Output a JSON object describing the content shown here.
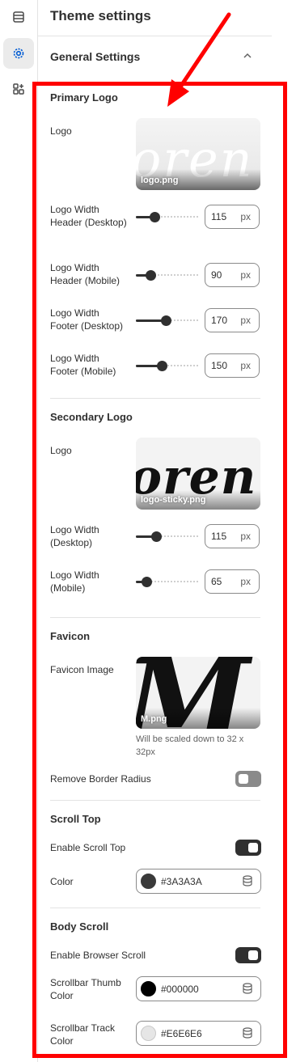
{
  "header": {
    "title": "Theme settings"
  },
  "rail": {
    "icons": [
      "sections-icon",
      "gear-icon",
      "apps-add-icon"
    ]
  },
  "general": {
    "label": "General Settings"
  },
  "primary_logo": {
    "title": "Primary Logo",
    "logo_label": "Logo",
    "logo_file": "logo.png",
    "logo_text": "oren",
    "width_header_desktop": {
      "label": "Logo Width Header (Desktop)",
      "value": "115",
      "unit": "px",
      "min": 0,
      "max": 500
    },
    "width_header_mobile": {
      "label": "Logo Width Header (Mobile)",
      "value": "90",
      "unit": "px",
      "min": 0,
      "max": 500
    },
    "width_footer_desktop": {
      "label": "Logo Width Footer (Desktop)",
      "value": "170",
      "unit": "px",
      "min": 0,
      "max": 500
    },
    "width_footer_mobile": {
      "label": "Logo Width Footer (Mobile)",
      "value": "150",
      "unit": "px",
      "min": 0,
      "max": 500
    }
  },
  "secondary_logo": {
    "title": "Secondary Logo",
    "logo_label": "Logo",
    "logo_file": "logo-sticky.png",
    "logo_text": "oren",
    "width_desktop": {
      "label": "Logo Width (Desktop)",
      "value": "115",
      "unit": "px"
    },
    "width_mobile": {
      "label": "Logo Width (Mobile)",
      "value": "65",
      "unit": "px"
    }
  },
  "favicon": {
    "title": "Favicon",
    "image_label": "Favicon Image",
    "file": "M.png",
    "glyph": "M",
    "helper": "Will be scaled down to 32 x 32px",
    "remove_radius_label": "Remove Border Radius",
    "remove_radius_on": false
  },
  "scroll_top": {
    "title": "Scroll Top",
    "enable_label": "Enable Scroll Top",
    "enable_on": true,
    "color_label": "Color",
    "color_hex": "#3A3A3A"
  },
  "body_scroll": {
    "title": "Body Scroll",
    "enable_label": "Enable Browser Scroll",
    "enable_on": true,
    "thumb_label": "Scrollbar Thumb Color",
    "thumb_hex": "#000000",
    "track_label": "Scrollbar Track Color",
    "track_hex": "#E6E6E6"
  },
  "colors": {
    "annotation": "#ff0000",
    "text": "#303030",
    "rail_active_icon": "#005bd3"
  }
}
